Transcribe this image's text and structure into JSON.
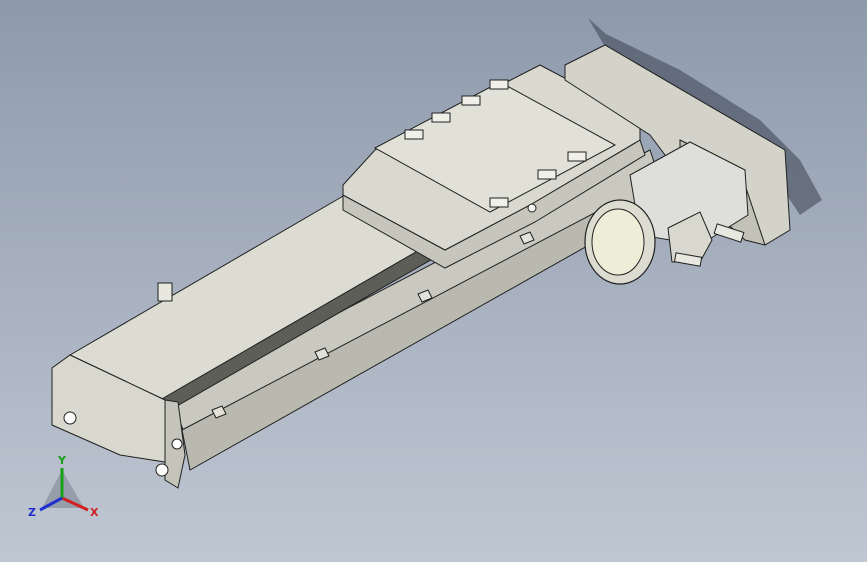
{
  "viewport": {
    "background_top": "#8e9aac",
    "background_bottom": "#bfc7d2"
  },
  "model": {
    "body_color": "#d6d6cc",
    "edge_color": "#202020",
    "motor_color": "#dcdcd2",
    "shadow_color": "#2b3340"
  },
  "triad": {
    "x_label": "X",
    "y_label": "Y",
    "z_label": "Z",
    "x_color": "#d22020",
    "y_color": "#18a018",
    "z_color": "#2030d0"
  }
}
